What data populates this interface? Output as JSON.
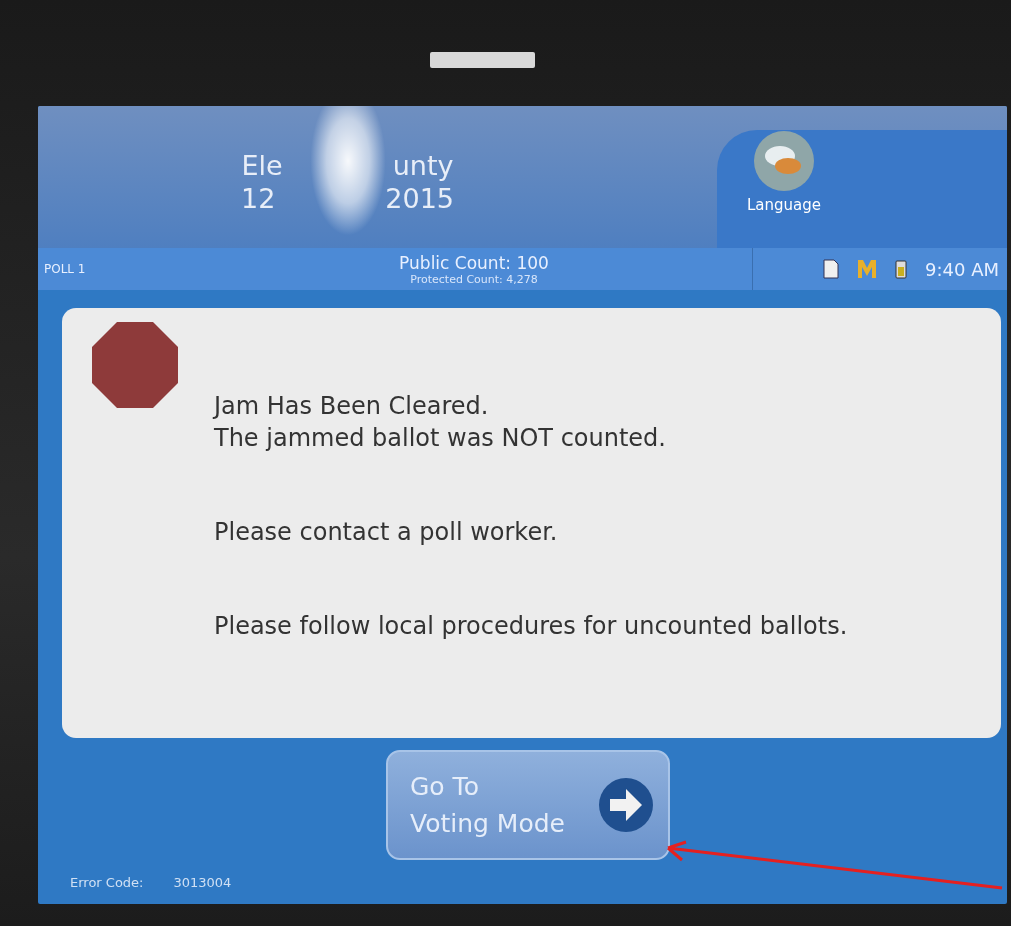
{
  "header": {
    "title_lines": [
      [
        "Ele",
        "unty"
      ],
      [
        "12",
        "2015"
      ]
    ],
    "language_button": "Language"
  },
  "status_bar": {
    "poll": "POLL 1",
    "public_count": "Public Count: 100",
    "protected_count": "Protected Count: 4,278",
    "time": "9:40 AM"
  },
  "message": {
    "lines": [
      "Jam Has Been Cleared.",
      "The jammed ballot was NOT counted.",
      "Please contact a poll worker.",
      "Please follow local procedures for uncounted ballots."
    ]
  },
  "footer": {
    "error_label": "Error Code:",
    "error_code": "3013004",
    "button": [
      "Go To",
      "Voting Mode"
    ]
  }
}
